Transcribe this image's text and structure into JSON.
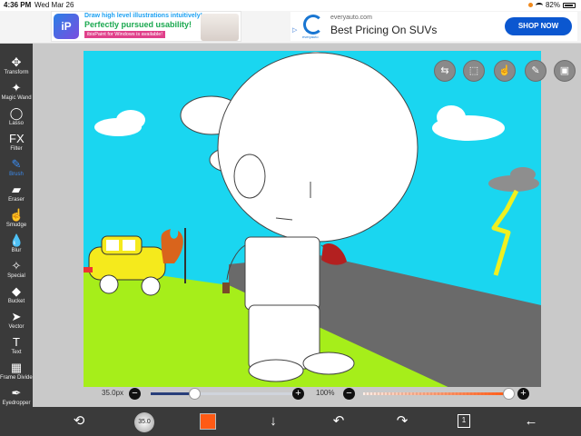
{
  "status_bar": {
    "time": "4:36 PM",
    "date": "Wed Mar 26",
    "battery": "82%"
  },
  "ads": {
    "left": {
      "line1": "Draw high level illustrations intuitively!",
      "line2": "Perfectly pursued usability!",
      "line3": "ibisPaint for Windows is available!"
    },
    "right": {
      "url": "everyauto.com",
      "headline": "Best Pricing On SUVs",
      "button": "SHOP NOW",
      "brand": "everyauto"
    }
  },
  "tools": [
    {
      "label": "Transform",
      "icon": "transform-icon",
      "glyph": "✥",
      "active": false
    },
    {
      "label": "Magic Wand",
      "icon": "magic-wand-icon",
      "glyph": "✦",
      "active": false
    },
    {
      "label": "Lasso",
      "icon": "lasso-icon",
      "glyph": "◯",
      "active": false
    },
    {
      "label": "Filter",
      "icon": "filter-icon",
      "glyph": "FX",
      "active": false
    },
    {
      "label": "Brush",
      "icon": "brush-icon",
      "glyph": "✎",
      "active": true
    },
    {
      "label": "Eraser",
      "icon": "eraser-icon",
      "glyph": "▰",
      "active": false
    },
    {
      "label": "Smudge",
      "icon": "smudge-icon",
      "glyph": "☝",
      "active": false
    },
    {
      "label": "Blur",
      "icon": "blur-icon",
      "glyph": "💧",
      "active": false
    },
    {
      "label": "Special",
      "icon": "special-icon",
      "glyph": "✧",
      "active": false
    },
    {
      "label": "Bucket",
      "icon": "bucket-icon",
      "glyph": "◆",
      "active": false
    },
    {
      "label": "Vector",
      "icon": "vector-icon",
      "glyph": "➤",
      "active": false
    },
    {
      "label": "Text",
      "icon": "text-icon",
      "glyph": "T",
      "active": false
    },
    {
      "label": "Frame Divider",
      "icon": "frame-divider-icon",
      "glyph": "▦",
      "active": false
    },
    {
      "label": "Eyedropper",
      "icon": "eyedropper-icon",
      "glyph": "✒",
      "active": false
    }
  ],
  "sliders": {
    "brush_size_text": "35.0px",
    "brush_size_fraction": 0.3,
    "opacity_text": "100%",
    "opacity_fraction": 1.0
  },
  "bottom_bar": {
    "brush_size_preview": "35.0",
    "layer_count": "1"
  },
  "colors": {
    "current_color": "#ff5a14",
    "sky": "#1ad6f0",
    "grass": "#a6ee1a",
    "toolbar": "#3a3a3a"
  }
}
